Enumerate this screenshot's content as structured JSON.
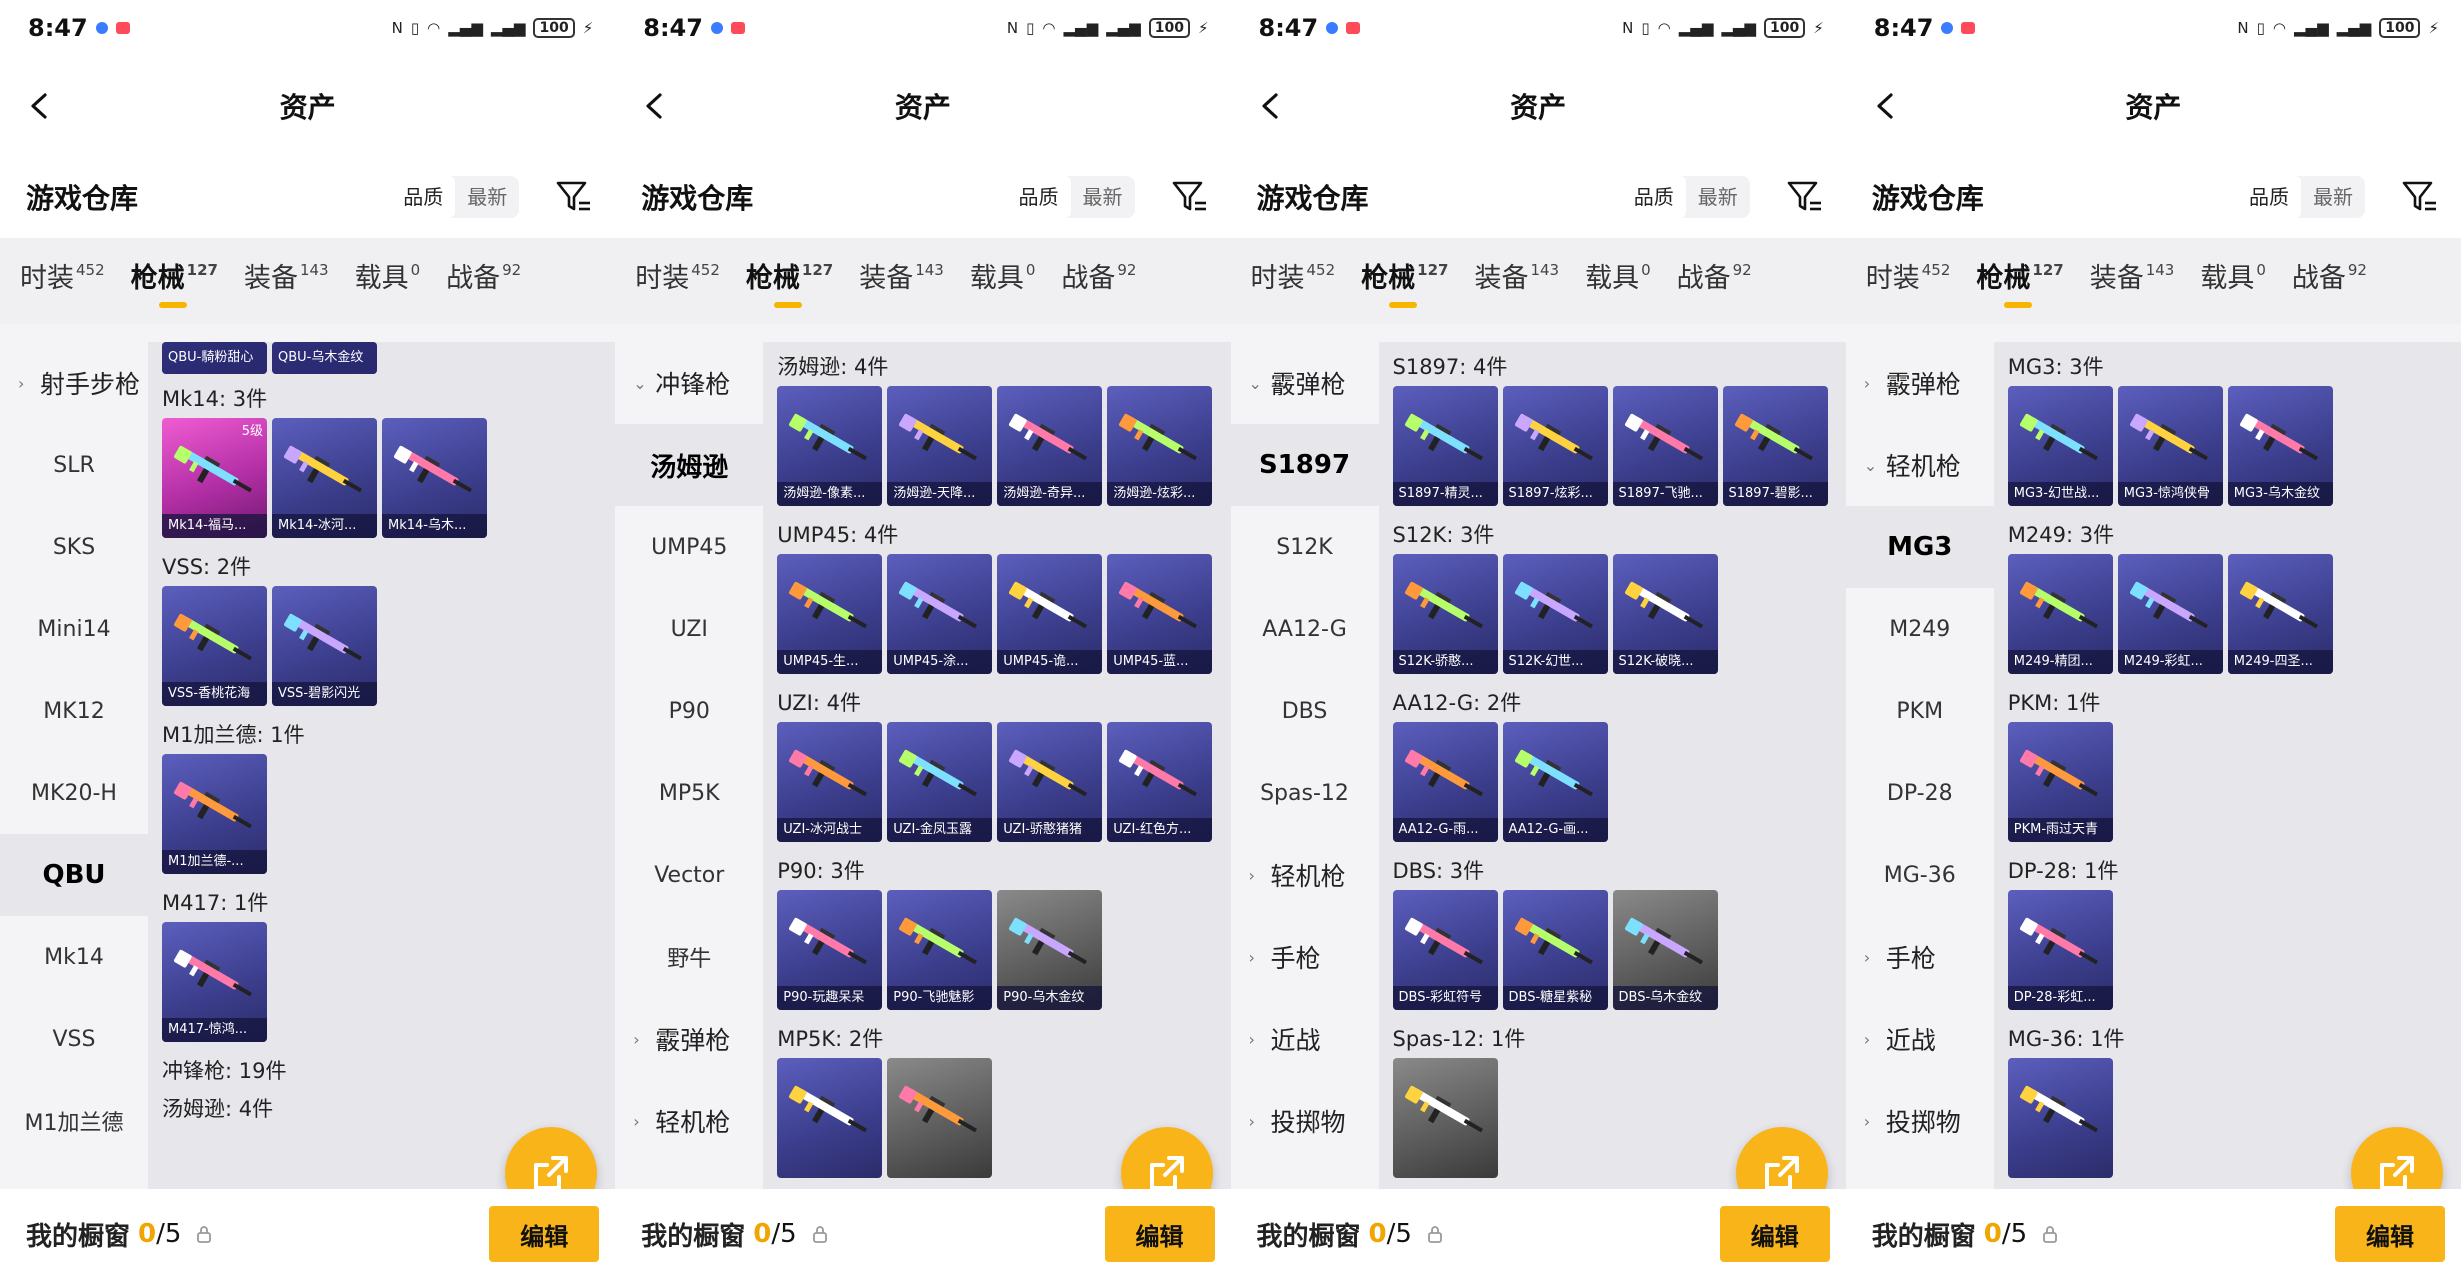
{
  "status": {
    "time": "8:47",
    "battery": "100"
  },
  "nav": {
    "title": "资产"
  },
  "warehouse": {
    "title": "游戏仓库",
    "sort_quality": "品质",
    "sort_latest": "最新"
  },
  "tabs": [
    {
      "label": "时装",
      "count": "452"
    },
    {
      "label": "枪械",
      "count": "127"
    },
    {
      "label": "装备",
      "count": "143"
    },
    {
      "label": "载具",
      "count": "0"
    },
    {
      "label": "战备",
      "count": "92"
    }
  ],
  "footer": {
    "label": "我的橱窗",
    "current": "0",
    "total": "/5",
    "edit": "编辑"
  },
  "panels": [
    {
      "sidebar": [
        {
          "label": "射手步枪",
          "group": true
        },
        {
          "label": "SLR"
        },
        {
          "label": "SKS"
        },
        {
          "label": "Mini14"
        },
        {
          "label": "MK12"
        },
        {
          "label": "MK20-H"
        },
        {
          "label": "QBU",
          "selected": true
        },
        {
          "label": "Mk14"
        },
        {
          "label": "VSS"
        },
        {
          "label": "M1加兰德"
        }
      ],
      "strip": [
        {
          "name": "QBU-騎粉甜心"
        },
        {
          "name": "QBU-乌木金纹"
        }
      ],
      "sections": [
        {
          "title": "Mk14: 3件",
          "items": [
            {
              "name": "Mk14-福马...",
              "style": "pink",
              "level": "5级"
            },
            {
              "name": "Mk14-冰河..."
            },
            {
              "name": "Mk14-乌木..."
            }
          ]
        },
        {
          "title": "VSS: 2件",
          "items": [
            {
              "name": "VSS-香桃花海"
            },
            {
              "name": "VSS-碧影闪光"
            }
          ]
        },
        {
          "title": "M1加兰德: 1件",
          "items": [
            {
              "name": "M1加兰德-..."
            }
          ]
        },
        {
          "title": "M417: 1件",
          "items": [
            {
              "name": "M417-惊鸿..."
            }
          ]
        },
        {
          "title": "冲锋枪: 19件",
          "items": []
        },
        {
          "title": "汤姆逊: 4件",
          "items": []
        }
      ]
    },
    {
      "sidebar": [
        {
          "label": "冲锋枪",
          "group": true,
          "open": true
        },
        {
          "label": "汤姆逊",
          "selected": true
        },
        {
          "label": "UMP45"
        },
        {
          "label": "UZI"
        },
        {
          "label": "P90"
        },
        {
          "label": "MP5K"
        },
        {
          "label": "Vector"
        },
        {
          "label": "野牛"
        },
        {
          "label": "霰弹枪",
          "group": true
        },
        {
          "label": "轻机枪",
          "group": true
        }
      ],
      "sections": [
        {
          "title": "汤姆逊: 4件",
          "items": [
            {
              "name": "汤姆逊-像素..."
            },
            {
              "name": "汤姆逊-天降..."
            },
            {
              "name": "汤姆逊-奇异..."
            },
            {
              "name": "汤姆逊-炫彩..."
            }
          ]
        },
        {
          "title": "UMP45: 4件",
          "items": [
            {
              "name": "UMP45-生..."
            },
            {
              "name": "UMP45-涂..."
            },
            {
              "name": "UMP45-诡..."
            },
            {
              "name": "UMP45-蓝..."
            }
          ]
        },
        {
          "title": "UZI: 4件",
          "items": [
            {
              "name": "UZI-冰河战士"
            },
            {
              "name": "UZI-金凤玉露"
            },
            {
              "name": "UZI-骄憨猪猪"
            },
            {
              "name": "UZI-红色方..."
            }
          ]
        },
        {
          "title": "P90: 3件",
          "items": [
            {
              "name": "P90-玩趣呆呆"
            },
            {
              "name": "P90-飞驰魅影"
            },
            {
              "name": "P90-乌木金纹",
              "style": "gray"
            }
          ]
        },
        {
          "title": "MP5K: 2件",
          "items": [
            {
              "name": ""
            },
            {
              "name": "",
              "style": "gray"
            }
          ]
        }
      ]
    },
    {
      "sidebar": [
        {
          "label": "霰弹枪",
          "group": true,
          "open": true
        },
        {
          "label": "S1897",
          "selected": true
        },
        {
          "label": "S12K"
        },
        {
          "label": "AA12-G"
        },
        {
          "label": "DBS"
        },
        {
          "label": "Spas-12"
        },
        {
          "label": "轻机枪",
          "group": true
        },
        {
          "label": "手枪",
          "group": true
        },
        {
          "label": "近战",
          "group": true
        },
        {
          "label": "投掷物",
          "group": true
        }
      ],
      "sections": [
        {
          "title": "S1897: 4件",
          "items": [
            {
              "name": "S1897-精灵..."
            },
            {
              "name": "S1897-炫彩..."
            },
            {
              "name": "S1897-飞驰..."
            },
            {
              "name": "S1897-碧影..."
            }
          ]
        },
        {
          "title": "S12K: 3件",
          "items": [
            {
              "name": "S12K-骄憨..."
            },
            {
              "name": "S12K-幻世..."
            },
            {
              "name": "S12K-破晓..."
            }
          ]
        },
        {
          "title": "AA12-G: 2件",
          "items": [
            {
              "name": "AA12-G-雨..."
            },
            {
              "name": "AA12-G-画..."
            }
          ]
        },
        {
          "title": "DBS: 3件",
          "items": [
            {
              "name": "DBS-彩虹符号"
            },
            {
              "name": "DBS-糖星紫秘"
            },
            {
              "name": "DBS-乌木金纹",
              "style": "gray"
            }
          ]
        },
        {
          "title": "Spas-12: 1件",
          "items": [
            {
              "name": "",
              "style": "gray"
            }
          ]
        }
      ]
    },
    {
      "sidebar": [
        {
          "label": "霰弹枪",
          "group": true
        },
        {
          "label": "轻机枪",
          "group": true,
          "open": true
        },
        {
          "label": "MG3",
          "selected": true
        },
        {
          "label": "M249"
        },
        {
          "label": "PKM"
        },
        {
          "label": "DP-28"
        },
        {
          "label": "MG-36"
        },
        {
          "label": "手枪",
          "group": true
        },
        {
          "label": "近战",
          "group": true
        },
        {
          "label": "投掷物",
          "group": true
        }
      ],
      "sections": [
        {
          "title": "MG3: 3件",
          "items": [
            {
              "name": "MG3-幻世战..."
            },
            {
              "name": "MG3-惊鸿侠骨"
            },
            {
              "name": "MG3-乌木金纹"
            }
          ]
        },
        {
          "title": "M249: 3件",
          "items": [
            {
              "name": "M249-精团..."
            },
            {
              "name": "M249-彩虹..."
            },
            {
              "name": "M249-四圣..."
            }
          ]
        },
        {
          "title": "PKM: 1件",
          "items": [
            {
              "name": "PKM-雨过天青"
            }
          ]
        },
        {
          "title": "DP-28: 1件",
          "items": [
            {
              "name": "DP-28-彩虹..."
            }
          ]
        },
        {
          "title": "MG-36: 1件",
          "items": [
            {
              "name": ""
            }
          ]
        }
      ]
    }
  ]
}
